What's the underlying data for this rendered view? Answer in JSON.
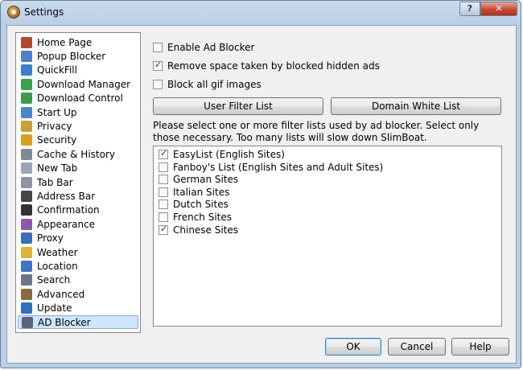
{
  "window": {
    "title": "Settings",
    "help_label": "?",
    "close_label": "✕"
  },
  "sidebar": {
    "items": [
      {
        "label": "Home Page",
        "icon": "home-icon",
        "color": "#b5472a"
      },
      {
        "label": "Popup Blocker",
        "icon": "popup-blocker-icon",
        "color": "#4f7fc4"
      },
      {
        "label": "QuickFill",
        "icon": "quickfill-icon",
        "color": "#3d7fd1"
      },
      {
        "label": "Download Manager",
        "icon": "download-manager-icon",
        "color": "#3aa24a"
      },
      {
        "label": "Download Control",
        "icon": "download-control-icon",
        "color": "#3d9c4a"
      },
      {
        "label": "Start Up",
        "icon": "startup-icon",
        "color": "#4a86c8"
      },
      {
        "label": "Privacy",
        "icon": "privacy-icon",
        "color": "#c9a037"
      },
      {
        "label": "Security",
        "icon": "security-lock-icon",
        "color": "#d8a21f"
      },
      {
        "label": "Cache & History",
        "icon": "cache-history-icon",
        "color": "#7f8a94"
      },
      {
        "label": "New Tab",
        "icon": "new-tab-icon",
        "color": "#9aa6b3"
      },
      {
        "label": "Tab Bar",
        "icon": "tab-bar-icon",
        "color": "#8c96a2"
      },
      {
        "label": "Address Bar",
        "icon": "address-bar-icon",
        "color": "#444"
      },
      {
        "label": "Confirmation",
        "icon": "confirmation-icon",
        "color": "#333"
      },
      {
        "label": "Appearance",
        "icon": "appearance-icon",
        "color": "#8c5aa8"
      },
      {
        "label": "Proxy",
        "icon": "proxy-icon",
        "color": "#3b6fb5"
      },
      {
        "label": "Weather",
        "icon": "weather-icon",
        "color": "#e0b23a"
      },
      {
        "label": "Location",
        "icon": "location-icon",
        "color": "#3f76c2"
      },
      {
        "label": "Search",
        "icon": "search-icon",
        "color": "#6a7784"
      },
      {
        "label": "Advanced",
        "icon": "advanced-tools-icon",
        "color": "#8a6a3a"
      },
      {
        "label": "Update",
        "icon": "update-globe-icon",
        "color": "#2f6fc2"
      },
      {
        "label": "AD Blocker",
        "icon": "ad-blocker-icon",
        "color": "#55657a",
        "selected": true
      }
    ]
  },
  "options": {
    "enable_ad_blocker": {
      "label": "Enable Ad Blocker",
      "checked": false
    },
    "remove_space": {
      "label": "Remove space taken by blocked hidden ads",
      "checked": true
    },
    "block_gif": {
      "label": "Block all gif images",
      "checked": false
    }
  },
  "buttons": {
    "user_filter_list": "User Filter List",
    "domain_white_list": "Domain White List",
    "ok": "OK",
    "cancel": "Cancel",
    "help": "Help"
  },
  "description": "Please select one or more filter lists used by ad blocker. Select only those necessary. Too many lists will slow down SlimBoat.",
  "filter_lists": [
    {
      "label": "EasyList (English Sites)",
      "checked": true
    },
    {
      "label": "Fanboy's List (English Sites and Adult Sites)",
      "checked": false
    },
    {
      "label": "German Sites",
      "checked": false
    },
    {
      "label": "Italian Sites",
      "checked": false
    },
    {
      "label": "Dutch Sites",
      "checked": false
    },
    {
      "label": "French Sites",
      "checked": false
    },
    {
      "label": "Chinese Sites",
      "checked": true
    }
  ]
}
